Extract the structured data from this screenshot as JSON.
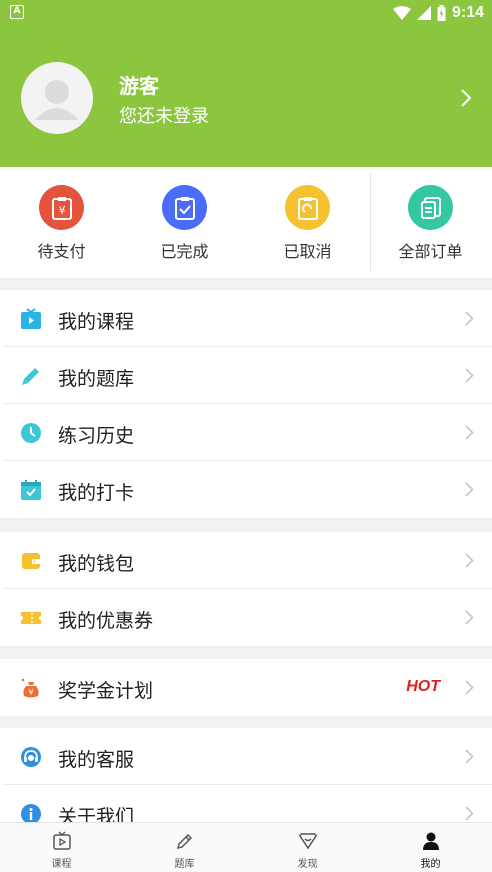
{
  "colors": {
    "header_bg": "#8cc63f",
    "pending": "#e5533d",
    "completed": "#4a6cf7",
    "cancelled": "#f5c12e",
    "all_orders": "#35c8a0",
    "hot": "#e02020"
  },
  "status_bar": {
    "time": "9:14",
    "app_icon": "A",
    "icons": [
      "wifi-icon",
      "signal-icon",
      "battery-icon"
    ]
  },
  "profile": {
    "name": "游客",
    "subtitle": "您还未登录",
    "avatar_icon": "person-avatar-icon"
  },
  "orders": [
    {
      "label": "待支付",
      "icon": "pending-payment-icon"
    },
    {
      "label": "已完成",
      "icon": "completed-icon"
    },
    {
      "label": "已取消",
      "icon": "cancelled-icon"
    },
    {
      "label": "全部订单",
      "icon": "all-orders-icon"
    }
  ],
  "menu_groups": [
    {
      "items": [
        {
          "label": "我的课程",
          "icon": "tv-icon"
        },
        {
          "label": "我的题库",
          "icon": "pencil-icon"
        },
        {
          "label": "练习历史",
          "icon": "clock-icon"
        },
        {
          "label": "我的打卡",
          "icon": "calendar-check-icon"
        }
      ]
    },
    {
      "items": [
        {
          "label": "我的钱包",
          "icon": "wallet-icon"
        },
        {
          "label": "我的优惠券",
          "icon": "coupon-icon"
        }
      ]
    },
    {
      "items": [
        {
          "label": "奖学金计划",
          "icon": "money-bag-icon",
          "badge": "HOT"
        }
      ]
    },
    {
      "items": [
        {
          "label": "我的客服",
          "icon": "headset-icon"
        },
        {
          "label": "关于我们",
          "icon": "info-icon"
        }
      ]
    }
  ],
  "bottom_nav": [
    {
      "label": "课程",
      "icon": "play-tv-icon",
      "active": false
    },
    {
      "label": "题库",
      "icon": "pencil-nav-icon",
      "active": false
    },
    {
      "label": "发现",
      "icon": "discover-icon",
      "active": false
    },
    {
      "label": "我的",
      "icon": "person-icon",
      "active": true
    }
  ]
}
